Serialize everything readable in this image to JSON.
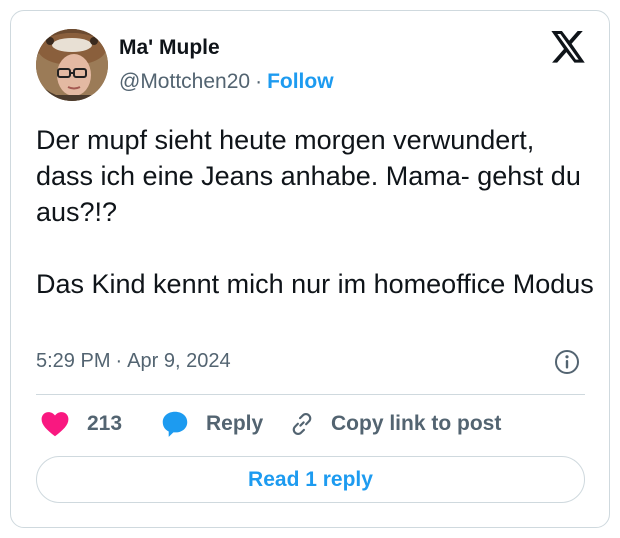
{
  "author": {
    "name": "Ma' Muple",
    "handle": "@Mottchen20",
    "separator": "·",
    "follow_label": "Follow"
  },
  "logo_icon": "x-logo-icon",
  "tweet": {
    "text": "Der mupf sieht heute morgen verwundert, dass ich eine Jeans anhabe. Mama- gehst du aus?!?\n\nDas Kind kennt mich nur im homeoffice Modus"
  },
  "meta": {
    "time": "5:29 PM",
    "separator": "·",
    "date": "Apr 9, 2024",
    "info_icon": "info-icon"
  },
  "actions": {
    "like_count": "213",
    "like_icon": "heart-icon",
    "reply_label": "Reply",
    "reply_icon": "speech-bubble-icon",
    "copy_label": "Copy link to post",
    "copy_icon": "link-icon"
  },
  "read_replies_label": "Read 1 reply",
  "colors": {
    "accent": "#1d9bf0",
    "like": "#f91880",
    "text": "#0f1419",
    "muted": "#536471",
    "border": "#cfd9de"
  }
}
